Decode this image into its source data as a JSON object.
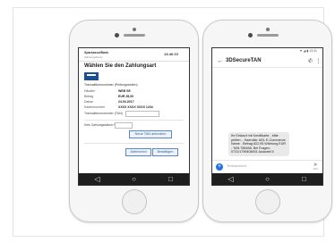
{
  "left_phone": {
    "header": {
      "bank": "Sparkasse/Bank",
      "subtitle": "Zahlungsdienst",
      "time": "13:46:10"
    },
    "heading": "Wählen Sie den Zahlungsart",
    "section_label": "Transaktionsnummer (Prüfungsstufen)",
    "rows": [
      {
        "key": "Händler",
        "value": "WEB SE"
      },
      {
        "key": "Betrag",
        "value": "EUR 28,00"
      },
      {
        "key": "Datum",
        "value": "24.03.2017"
      },
      {
        "key": "Kartennummer",
        "value": "XXXX XXXX XXXX 1234"
      }
    ],
    "tan_field_label": "Transaktionsnummer (TAN)",
    "second_label": "Kein Zahlungsdatum?",
    "request_tan_button": "Neue TAN anfordern",
    "cancel_button": "Abbrechen",
    "confirm_button": "Bestätigen"
  },
  "right_phone": {
    "status_bar": "▼ ◢ ▮ 13:31",
    "title": "3DSecureTAN",
    "message": "Ihr Einkauf mit Kreditkarte - bitte prüfen: - Haendler UDL E-Commerce Name - Betrag 822,95 Währung EUR - TAN 785468. Bei Fragen: 0731/1799408001 Auswahl 5",
    "composer_placeholder": "Textnachricht",
    "send_label": "SMS"
  },
  "nav_icons": [
    "back-triangle-icon",
    "home-circle-icon",
    "recents-square-icon"
  ],
  "colors": {
    "brand": "#1c4f8f",
    "accent": "#1a73e8",
    "button_border": "#5a86c9"
  }
}
